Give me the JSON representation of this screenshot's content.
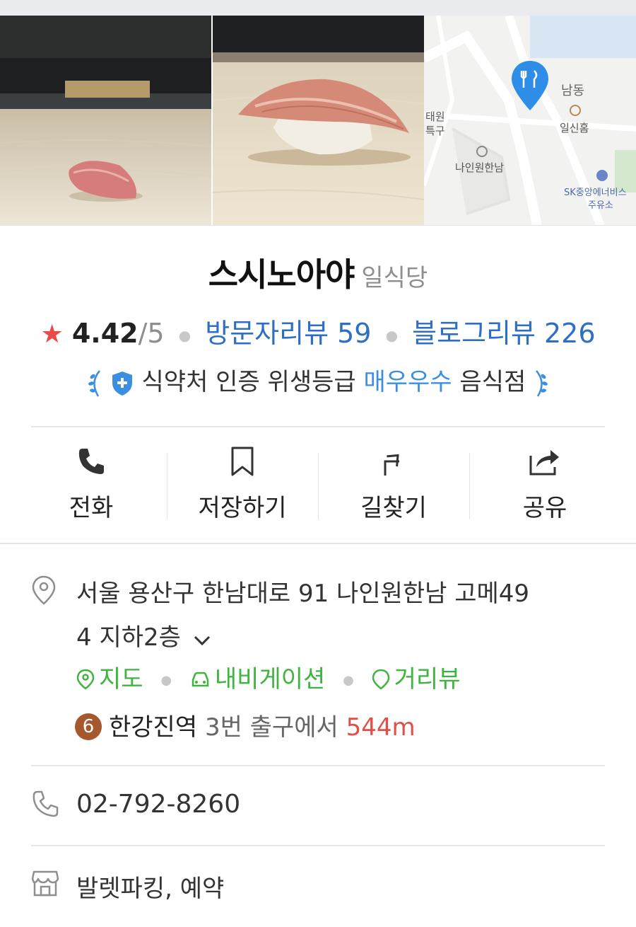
{
  "restaurant": {
    "name": "스시노아야",
    "category": "일식당",
    "rating": "4.42",
    "rating_max": "/5",
    "visitor_reviews": "방문자리뷰 59",
    "blog_reviews": "블로그리뷰 226"
  },
  "hygiene": {
    "prefix": "식약처 인증 위생등급",
    "grade": "매우우수",
    "suffix": "음식점"
  },
  "map_thumb": {
    "labels": [
      "남동",
      "일신홈",
      "태원",
      "특구",
      "나인원한남",
      "SK중앙에너비스",
      "주유소"
    ]
  },
  "actions": [
    {
      "label": "전화",
      "icon": "phone-icon"
    },
    {
      "label": "저장하기",
      "icon": "bookmark-icon"
    },
    {
      "label": "길찾기",
      "icon": "directions-icon"
    },
    {
      "label": "공유",
      "icon": "share-icon"
    }
  ],
  "address": {
    "text": "서울 용산구 한남대로 91 나인원한남 고메49",
    "text2": "4 지하2층"
  },
  "map_links": [
    "지도",
    "내비게이션",
    "거리뷰"
  ],
  "transit": {
    "line": "6",
    "station": "한강진역",
    "exit_text": "3번 출구에서",
    "distance": "544m"
  },
  "phone": "02-792-8260",
  "amenities": "발렛파킹, 예약",
  "colors": {
    "link_blue": "#2e6fc5",
    "hygiene_blue": "#3b8fe0",
    "green": "#3fb43f",
    "star_red": "#ea4a4a",
    "distance_red": "#e0504a",
    "line6_brown": "#a4582c"
  }
}
